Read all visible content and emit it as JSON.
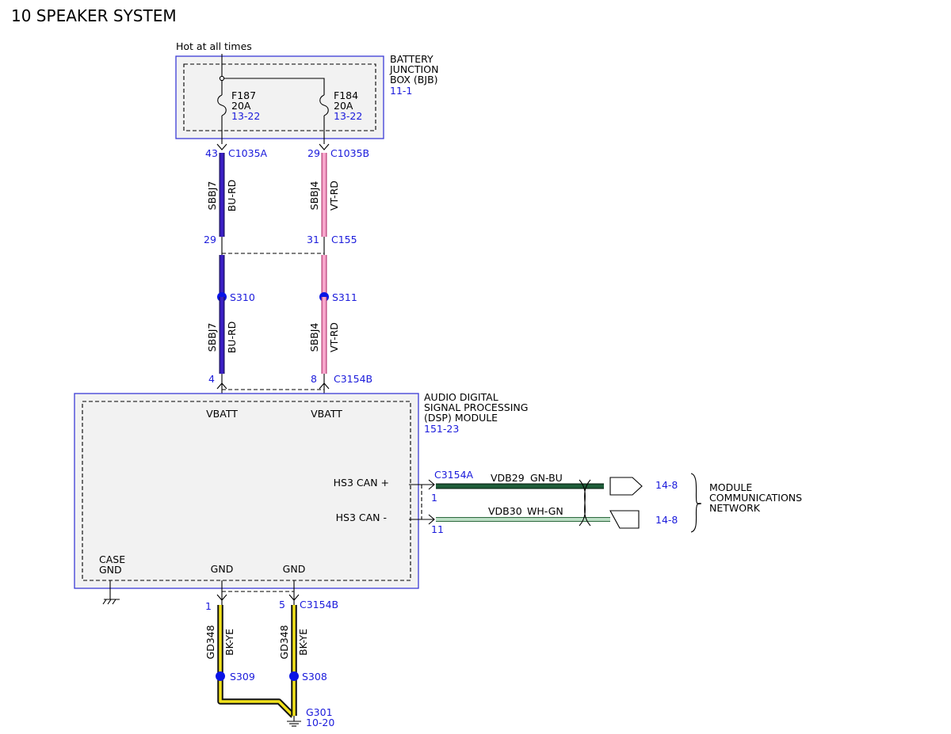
{
  "title": "10 SPEAKER SYSTEM",
  "hot_label": "Hot at all times",
  "bjb": {
    "name_line1": "BATTERY",
    "name_line2": "JUNCTION",
    "name_line3": "BOX (BJB)",
    "ref": "11-1",
    "fuses": [
      {
        "id": "F187",
        "rating": "20A",
        "ref": "13-22"
      },
      {
        "id": "F184",
        "rating": "20A",
        "ref": "13-22"
      }
    ]
  },
  "connectors": {
    "c1035a": "C1035A",
    "c1035b": "C1035B",
    "c155": "C155",
    "c3154b_top": "C3154B",
    "c3154a": "C3154A",
    "c3154b_bottom": "C3154B"
  },
  "pins": {
    "c1035a_pin": "43",
    "c1035b_pin": "29",
    "c155_left": "29",
    "c155_right": "31",
    "c3154b_left": "4",
    "c3154b_right": "8",
    "can_plus_pin": "1",
    "can_minus_pin": "11",
    "gnd_left_pin": "1",
    "gnd_right_pin": "5"
  },
  "wires": {
    "left_upper": {
      "circuit": "SBBJ7",
      "color": "BU-RD"
    },
    "right_upper": {
      "circuit": "SBBJ4",
      "color": "VT-RD"
    },
    "left_lower": {
      "circuit": "SBBJ7",
      "color": "BU-RD"
    },
    "right_lower": {
      "circuit": "SBBJ4",
      "color": "VT-RD"
    },
    "can_plus": {
      "circuit": "VDB29",
      "color": "GN-BU"
    },
    "can_minus": {
      "circuit": "VDB30",
      "color": "WH-GN"
    },
    "gnd_left": {
      "circuit": "GD348",
      "color": "BK-YE"
    },
    "gnd_right": {
      "circuit": "GD348",
      "color": "BK-YE"
    }
  },
  "splices": {
    "s310": "S310",
    "s311": "S311",
    "s309": "S309",
    "s308": "S308"
  },
  "dsp": {
    "name_line1": "AUDIO DIGITAL",
    "name_line2": "SIGNAL PROCESSING",
    "name_line3": "(DSP) MODULE",
    "ref": "151-23",
    "vbatt_left": "VBATT",
    "vbatt_right": "VBATT",
    "can_plus": "HS3 CAN +",
    "can_minus": "HS3 CAN -",
    "case_line1": "CASE",
    "case_line2": "GND",
    "gnd_left": "GND",
    "gnd_right": "GND"
  },
  "network": {
    "ref_plus": "14-8",
    "ref_minus": "14-8",
    "line1": "MODULE",
    "line2": "COMMUNICATIONS",
    "line3": "NETWORK"
  },
  "ground": {
    "id": "G301",
    "ref": "10-20"
  },
  "colors": {
    "box_border": "#3b3bd6",
    "box_fill": "#f2f2f2",
    "reference_text": "#1a1adb",
    "splice": "#0a14e6",
    "wire_bu_rd": "#3a1fc2",
    "wire_vt_rd": "#ee6fa8",
    "wire_gn_bu": "#1f5e3a",
    "wire_wh_gn": "#8fcf9f",
    "wire_bk_ye": "#f2e21a"
  }
}
